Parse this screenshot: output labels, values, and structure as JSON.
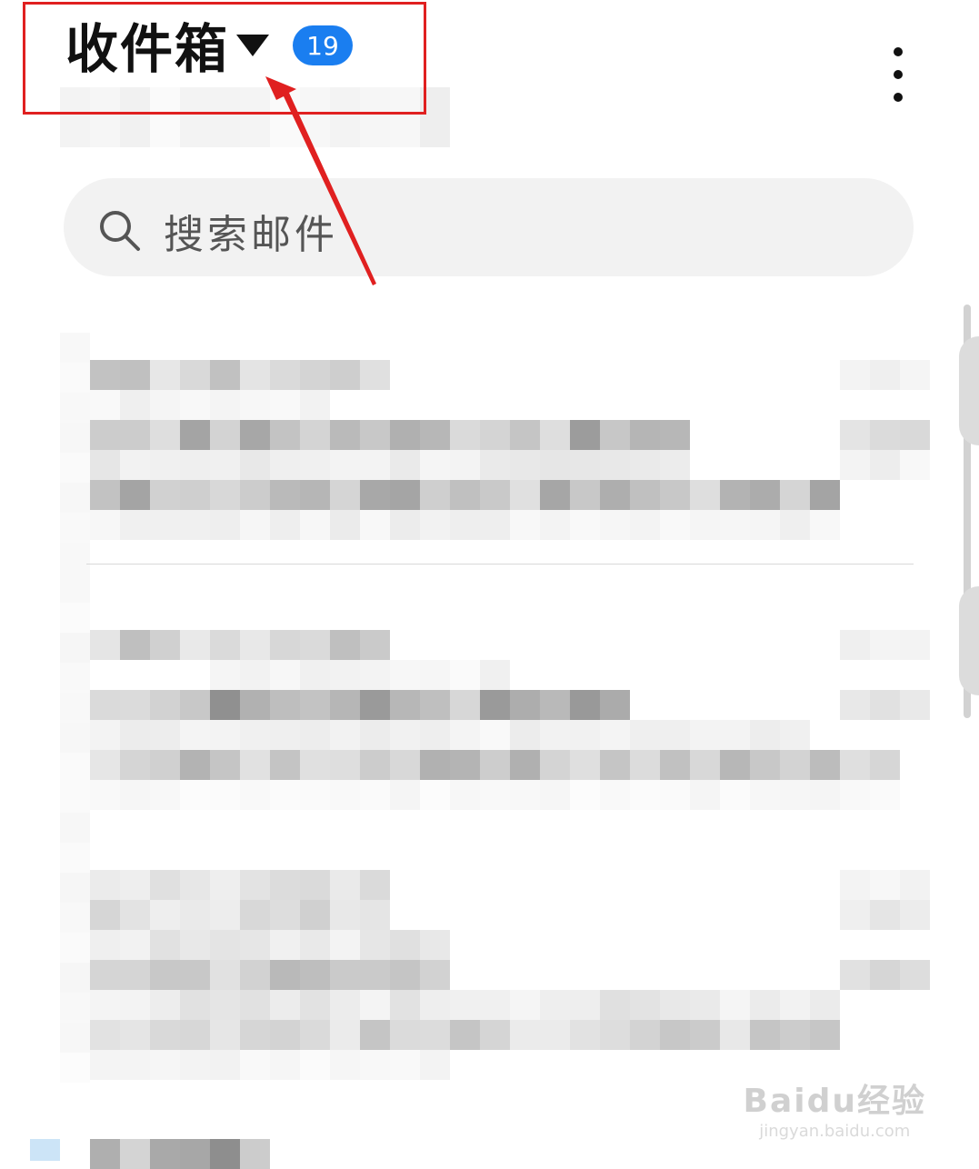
{
  "header": {
    "title": "收件箱",
    "unread_count": "19",
    "dropdown_icon": "triangle-down-icon",
    "more_icon": "vertical-ellipsis-icon"
  },
  "search": {
    "placeholder": "搜索邮件",
    "icon": "search-icon"
  },
  "watermark": {
    "text": "Baidu经验",
    "url": "jingyan.baidu.com"
  },
  "colors": {
    "badge": "#1a7ef0",
    "highlight": "#e02020",
    "search_bg": "#f2f2f2"
  }
}
